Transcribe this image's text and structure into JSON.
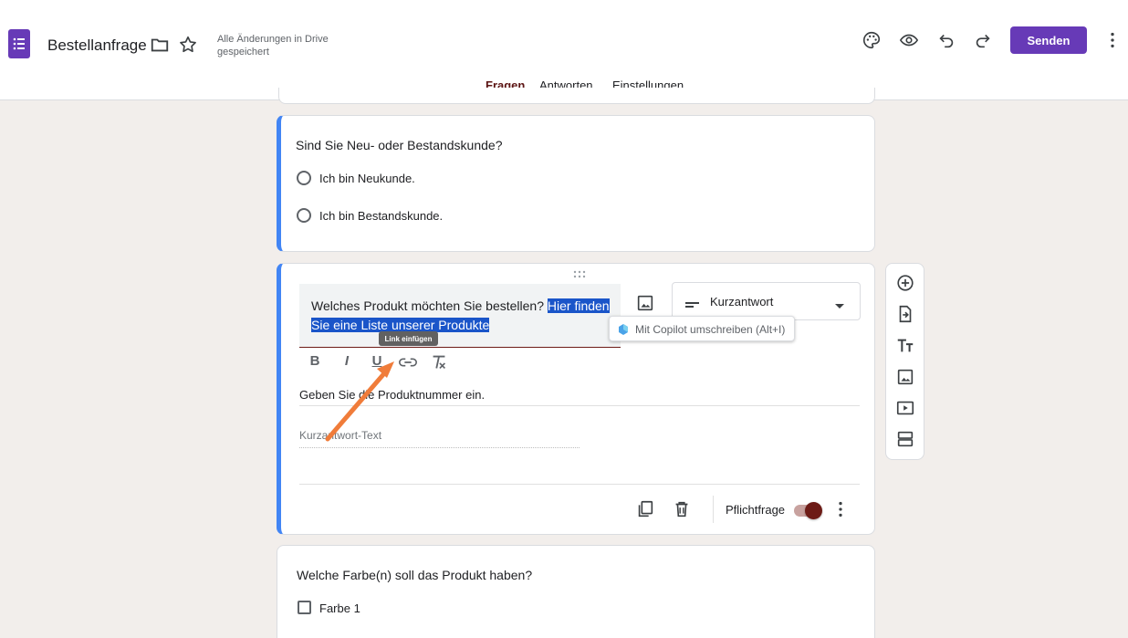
{
  "header": {
    "title": "Bestellanfrage",
    "save_status": "Alle Änderungen in Drive gespeichert",
    "send_label": "Senden"
  },
  "tabs": [
    {
      "label": "Fragen",
      "active": true
    },
    {
      "label": "Antworten",
      "active": false
    },
    {
      "label": "Einstellungen",
      "active": false
    }
  ],
  "question1": {
    "title": "Sind Sie Neu- oder Bestandskunde?",
    "options": [
      "Ich bin Neukunde.",
      "Ich bin Bestandskunde."
    ]
  },
  "question2": {
    "title_plain": "Welches Produkt möchten Sie bestellen? ",
    "title_selected_a": "Hier finden",
    "title_selected_b": "Sie eine Liste unserer Produkte",
    "type_label": "Kurzantwort",
    "copilot_text": "Mit Copilot umschreiben  (Alt+I)",
    "link_tooltip": "Link einfügen",
    "format_buttons": [
      "B",
      "I",
      "U"
    ],
    "description": "Geben Sie die Produktnummer ein.",
    "answer_placeholder": "Kurzantwort-Text",
    "required_label": "Pflichtfrage",
    "required_on": true
  },
  "question3": {
    "title": "Welche Farbe(n) soll das Produkt haben?",
    "options": [
      "Farbe 1"
    ]
  },
  "colors": {
    "brand": "#673ab7",
    "accent": "#6d1b16",
    "focus_bar": "#4285f4",
    "annotation_arrow": "#f07c3a"
  }
}
